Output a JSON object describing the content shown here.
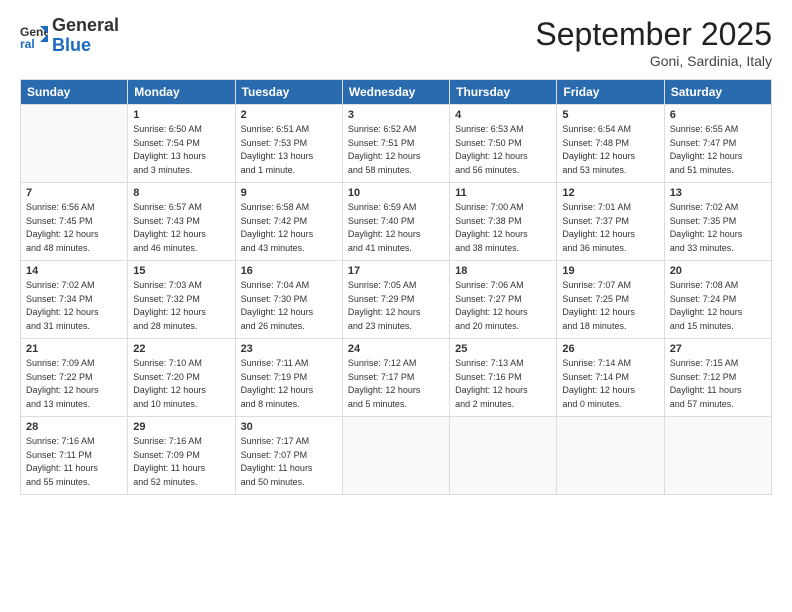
{
  "header": {
    "logo_general": "General",
    "logo_blue": "Blue",
    "month_title": "September 2025",
    "location": "Goni, Sardinia, Italy"
  },
  "days_of_week": [
    "Sunday",
    "Monday",
    "Tuesday",
    "Wednesday",
    "Thursday",
    "Friday",
    "Saturday"
  ],
  "weeks": [
    [
      {
        "day": "",
        "info": ""
      },
      {
        "day": "1",
        "info": "Sunrise: 6:50 AM\nSunset: 7:54 PM\nDaylight: 13 hours\nand 3 minutes."
      },
      {
        "day": "2",
        "info": "Sunrise: 6:51 AM\nSunset: 7:53 PM\nDaylight: 13 hours\nand 1 minute."
      },
      {
        "day": "3",
        "info": "Sunrise: 6:52 AM\nSunset: 7:51 PM\nDaylight: 12 hours\nand 58 minutes."
      },
      {
        "day": "4",
        "info": "Sunrise: 6:53 AM\nSunset: 7:50 PM\nDaylight: 12 hours\nand 56 minutes."
      },
      {
        "day": "5",
        "info": "Sunrise: 6:54 AM\nSunset: 7:48 PM\nDaylight: 12 hours\nand 53 minutes."
      },
      {
        "day": "6",
        "info": "Sunrise: 6:55 AM\nSunset: 7:47 PM\nDaylight: 12 hours\nand 51 minutes."
      }
    ],
    [
      {
        "day": "7",
        "info": "Sunrise: 6:56 AM\nSunset: 7:45 PM\nDaylight: 12 hours\nand 48 minutes."
      },
      {
        "day": "8",
        "info": "Sunrise: 6:57 AM\nSunset: 7:43 PM\nDaylight: 12 hours\nand 46 minutes."
      },
      {
        "day": "9",
        "info": "Sunrise: 6:58 AM\nSunset: 7:42 PM\nDaylight: 12 hours\nand 43 minutes."
      },
      {
        "day": "10",
        "info": "Sunrise: 6:59 AM\nSunset: 7:40 PM\nDaylight: 12 hours\nand 41 minutes."
      },
      {
        "day": "11",
        "info": "Sunrise: 7:00 AM\nSunset: 7:38 PM\nDaylight: 12 hours\nand 38 minutes."
      },
      {
        "day": "12",
        "info": "Sunrise: 7:01 AM\nSunset: 7:37 PM\nDaylight: 12 hours\nand 36 minutes."
      },
      {
        "day": "13",
        "info": "Sunrise: 7:02 AM\nSunset: 7:35 PM\nDaylight: 12 hours\nand 33 minutes."
      }
    ],
    [
      {
        "day": "14",
        "info": "Sunrise: 7:02 AM\nSunset: 7:34 PM\nDaylight: 12 hours\nand 31 minutes."
      },
      {
        "day": "15",
        "info": "Sunrise: 7:03 AM\nSunset: 7:32 PM\nDaylight: 12 hours\nand 28 minutes."
      },
      {
        "day": "16",
        "info": "Sunrise: 7:04 AM\nSunset: 7:30 PM\nDaylight: 12 hours\nand 26 minutes."
      },
      {
        "day": "17",
        "info": "Sunrise: 7:05 AM\nSunset: 7:29 PM\nDaylight: 12 hours\nand 23 minutes."
      },
      {
        "day": "18",
        "info": "Sunrise: 7:06 AM\nSunset: 7:27 PM\nDaylight: 12 hours\nand 20 minutes."
      },
      {
        "day": "19",
        "info": "Sunrise: 7:07 AM\nSunset: 7:25 PM\nDaylight: 12 hours\nand 18 minutes."
      },
      {
        "day": "20",
        "info": "Sunrise: 7:08 AM\nSunset: 7:24 PM\nDaylight: 12 hours\nand 15 minutes."
      }
    ],
    [
      {
        "day": "21",
        "info": "Sunrise: 7:09 AM\nSunset: 7:22 PM\nDaylight: 12 hours\nand 13 minutes."
      },
      {
        "day": "22",
        "info": "Sunrise: 7:10 AM\nSunset: 7:20 PM\nDaylight: 12 hours\nand 10 minutes."
      },
      {
        "day": "23",
        "info": "Sunrise: 7:11 AM\nSunset: 7:19 PM\nDaylight: 12 hours\nand 8 minutes."
      },
      {
        "day": "24",
        "info": "Sunrise: 7:12 AM\nSunset: 7:17 PM\nDaylight: 12 hours\nand 5 minutes."
      },
      {
        "day": "25",
        "info": "Sunrise: 7:13 AM\nSunset: 7:16 PM\nDaylight: 12 hours\nand 2 minutes."
      },
      {
        "day": "26",
        "info": "Sunrise: 7:14 AM\nSunset: 7:14 PM\nDaylight: 12 hours\nand 0 minutes."
      },
      {
        "day": "27",
        "info": "Sunrise: 7:15 AM\nSunset: 7:12 PM\nDaylight: 11 hours\nand 57 minutes."
      }
    ],
    [
      {
        "day": "28",
        "info": "Sunrise: 7:16 AM\nSunset: 7:11 PM\nDaylight: 11 hours\nand 55 minutes."
      },
      {
        "day": "29",
        "info": "Sunrise: 7:16 AM\nSunset: 7:09 PM\nDaylight: 11 hours\nand 52 minutes."
      },
      {
        "day": "30",
        "info": "Sunrise: 7:17 AM\nSunset: 7:07 PM\nDaylight: 11 hours\nand 50 minutes."
      },
      {
        "day": "",
        "info": ""
      },
      {
        "day": "",
        "info": ""
      },
      {
        "day": "",
        "info": ""
      },
      {
        "day": "",
        "info": ""
      }
    ]
  ]
}
